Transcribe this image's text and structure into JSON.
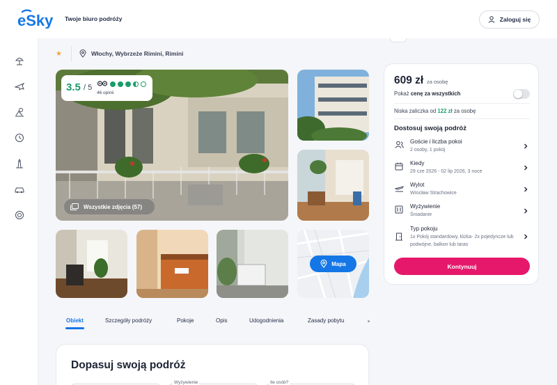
{
  "header": {
    "logo_text": "eSky",
    "tagline": "Twoje biuro podróży",
    "login_label": "Zaloguj się",
    "brand_color": "#1577e6"
  },
  "sidebar": {
    "icons": [
      "beach-umbrella-icon",
      "plane-icon",
      "beach-chair-icon",
      "clock-icon",
      "lighthouse-icon",
      "car-icon",
      "lifebuoy-icon"
    ]
  },
  "breadcrumb": {
    "star": "★",
    "location": "Włochy, Wybrzeże Rimini, Rimini"
  },
  "gallery": {
    "rating": "3.5",
    "rating_max": "/ 5",
    "reviews": "46 opinii",
    "dots": [
      "full",
      "full",
      "full",
      "half",
      "empty"
    ],
    "all_photos_label": "Wszystkie zdjęcia (57)",
    "map_label": "Mapa"
  },
  "tabs": {
    "items": [
      "Obiekt",
      "Szczegóły podróży",
      "Pokoje",
      "Opis",
      "Udogodnienia",
      "Zasady pobytu"
    ],
    "active": "Obiekt"
  },
  "fit_section": {
    "title": "Dopasuj swoją podróż",
    "field_labels": [
      "Wyżywienie",
      "Ile osób?"
    ]
  },
  "booking": {
    "price": "609 zł",
    "price_unit": "za osobę",
    "all_price_prefix": "Pokaż ",
    "all_price_bold": "cenę za wszystkich",
    "all_price_enabled": false,
    "deposit_prefix": "Niska zaliczka od ",
    "deposit_amount": "122 zł",
    "deposit_suffix": " za osobę",
    "customize_title": "Dostosuj swoją podróż",
    "options": [
      {
        "icon": "guests-icon",
        "title": "Goście i liczba pokoi",
        "sub": "2 osoby, 1 pokój"
      },
      {
        "icon": "calendar-icon",
        "title": "Kiedy",
        "sub": "29 cze 2026 - 02 lip 2026, 3 noce"
      },
      {
        "icon": "departure-icon",
        "title": "Wylot",
        "sub": "Wrocław Strachowice"
      },
      {
        "icon": "meal-icon",
        "title": "Wyżywienie",
        "sub": "Śniadanie"
      },
      {
        "icon": "room-door-icon",
        "title": "Typ pokoju",
        "sub": "1x Pokój standardowy, łóżka- 2x pojedyncze lub podwójne, balkon lub taras"
      }
    ],
    "continue_label": "Kontynuuj",
    "accent_color": "#e6186c"
  }
}
